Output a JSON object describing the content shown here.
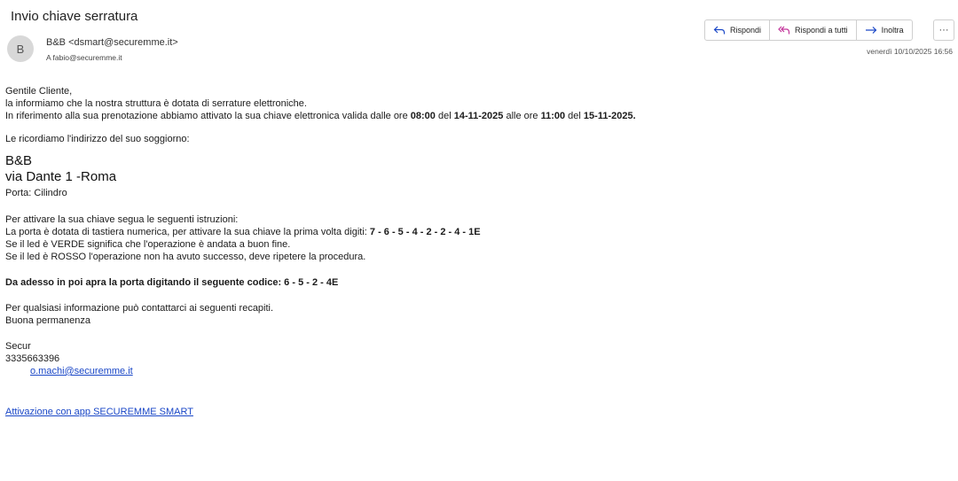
{
  "email": {
    "subject": "Invio chiave serratura",
    "avatar_initial": "B",
    "from": "B&B <dsmart@securemme.it>",
    "to": "A  fabio@securemme.it",
    "date": "venerdì 10/10/2025 16:56"
  },
  "toolbar": {
    "reply_label": "Rispondi",
    "reply_all_label": "Rispondi a tutti",
    "forward_label": "Inoltra",
    "more_label": "···"
  },
  "colors": {
    "accent": "#1a47c7",
    "reply_all_icon": "#c2339a"
  },
  "body": {
    "greeting": "Gentile Cliente,",
    "line1": "la informiamo che la nostra struttura è dotata di serrature elettroniche.",
    "line2": {
      "t1": "In riferimento alla sua prenotazione abbiamo attivato la sua chiave elettronica valida dalle ore ",
      "b1": "08:00",
      "t2": " del ",
      "b2": "14-11-2025",
      "t3": " alle ore ",
      "b3": "11:00",
      "t4": " del ",
      "b4": "15-11-2025."
    },
    "address_intro": "Le ricordiamo l'indirizzo del suo soggiorno:",
    "address_name": "B&B",
    "address_street": "via Dante 1 -Roma",
    "door": "Porta:  Cilindro",
    "instr_intro": "Per attivare la sua chiave segua le seguenti istruzioni:",
    "instr_line": {
      "text": "La porta è dotata di tastiera numerica, per attivare la sua chiave la prima volta digiti: ",
      "code": "7 - 6 - 5 - 4 - 2 - 2 - 4 - 1E"
    },
    "led_green": "Se il led è VERDE significa che l'operazione è andata a buon fine.",
    "led_red": "Se il led è ROSSO l'operazione non ha avuto successo, deve ripetere la procedura.",
    "code_line": "Da adesso in poi apra la porta digitando il seguente codice: 6 - 5 - 2 - 4E",
    "contact_intro": "Per qualsiasi informazione può contattarci ai seguenti recapiti.",
    "farewell": "Buona permanenza",
    "sig_name": "Secur",
    "sig_phone": "3335663396",
    "sig_email": "o.machi@securemme.it",
    "app_link": "Attivazione con app SECUREMME SMART"
  }
}
